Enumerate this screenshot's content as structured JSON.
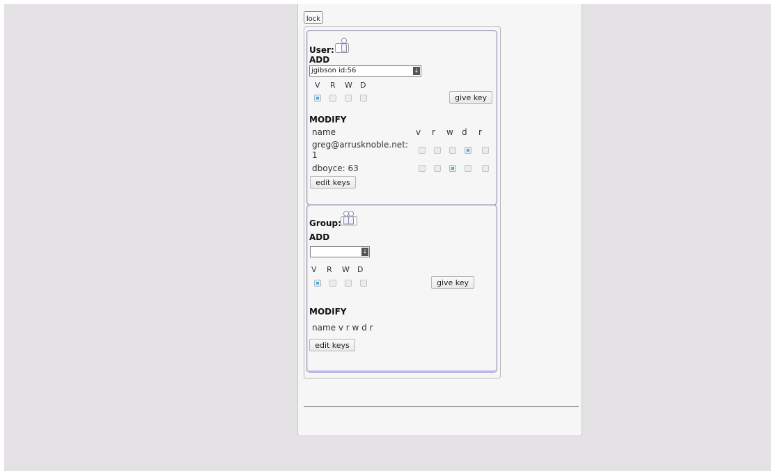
{
  "lock_label": "lock",
  "user": {
    "title": "User:",
    "add_label": "ADD",
    "selected_user": "jgibson id:56",
    "perm_headers": [
      "V",
      "R",
      "W",
      "D"
    ],
    "perm_checked": [
      true,
      false,
      false,
      false
    ],
    "give_key_label": "give key",
    "modify_label": "MODIFY",
    "modify_headers": [
      "name",
      "v",
      "r",
      "w",
      "d",
      "r"
    ],
    "rows": [
      {
        "name": "greg@arrusknoble.net:",
        "name_cont": "1",
        "checks": [
          false,
          false,
          false,
          true,
          false
        ]
      },
      {
        "name": "dboyce: 63",
        "checks": [
          false,
          false,
          true,
          false,
          false
        ]
      }
    ],
    "edit_keys_label": "edit keys"
  },
  "group": {
    "title": "Group:",
    "add_label": "ADD",
    "selected_group": "",
    "perm_headers": [
      "V",
      "R",
      "W",
      "D"
    ],
    "perm_checked": [
      true,
      false,
      false,
      false
    ],
    "give_key_label": "give key",
    "modify_label": "MODIFY",
    "modify_header_text": "name v r w d r",
    "edit_keys_label": "edit keys"
  },
  "icons": {
    "user": "user-silhouette-icon",
    "group": "group-users-icon",
    "dropdown": "dropdown-arrow-icon"
  },
  "colors": {
    "check_accent": "#48aee3",
    "section_border": "#b8b8ec",
    "page_bg": "#e5e2e5"
  }
}
